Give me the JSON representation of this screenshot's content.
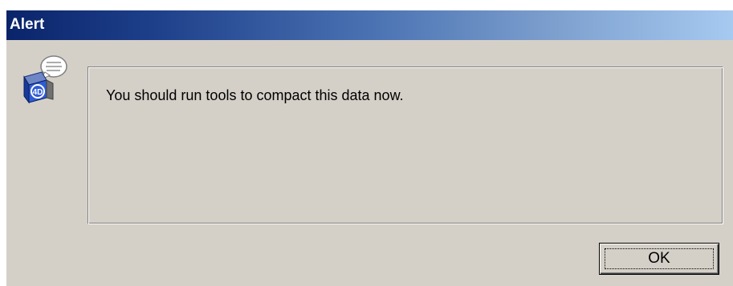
{
  "window": {
    "title": "Alert"
  },
  "icon": {
    "name": "4d-database-icon"
  },
  "message": {
    "text": "You should run tools to compact this data now."
  },
  "buttons": {
    "ok_label": "OK"
  },
  "colors": {
    "titlebar_start": "#0a246a",
    "titlebar_end": "#a6caf0",
    "dialog_background": "#d4d0c8"
  }
}
